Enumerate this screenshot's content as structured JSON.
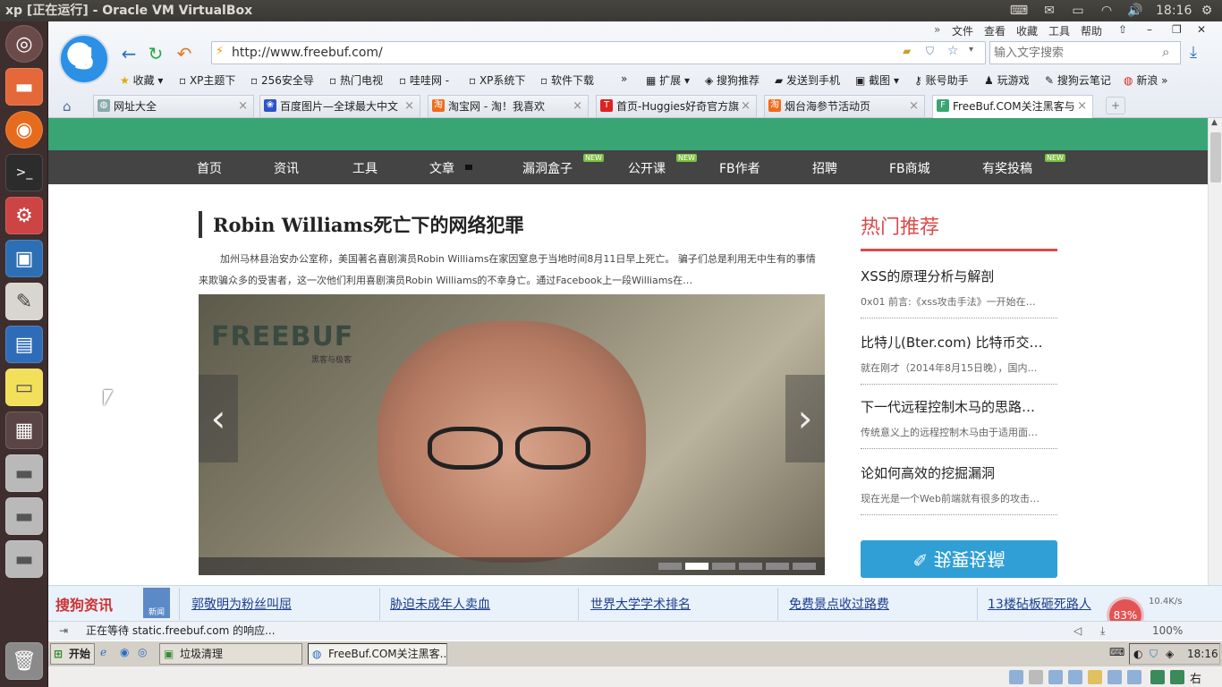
{
  "top_panel": {
    "title": "xp [正在运行] - Oracle VM VirtualBox",
    "clock": "18:16"
  },
  "launcher": {
    "items": [
      "ubuntu-dash",
      "files",
      "firefox",
      "terminal",
      "settings",
      "virtualbox",
      "text-editor",
      "libreoffice-writer",
      "sticky-notes",
      "workspace-switcher",
      "drive-1",
      "drive-2",
      "drive-3",
      "trash"
    ]
  },
  "browser": {
    "menu": [
      "文件",
      "查看",
      "收藏",
      "工具",
      "帮助"
    ],
    "url": "http://www.freebuf.com/",
    "search_placeholder": "输入文字搜索",
    "bookmarks": [
      "收藏",
      "XP主题下",
      "256安全导",
      "热门电视",
      "哇哇网 -",
      "XP系统下",
      "软件下载",
      "扩展",
      "搜狗推荐",
      "发送到手机",
      "截图",
      "账号助手",
      "玩游戏",
      "搜狗云笔记",
      "新浪"
    ],
    "tabs": [
      {
        "label": "网址大全",
        "active": false
      },
      {
        "label": "百度图片—全球最大中文",
        "active": false
      },
      {
        "label": "淘宝网 - 淘！我喜欢",
        "active": false
      },
      {
        "label": "首页-Huggies好奇官方旗",
        "active": false
      },
      {
        "label": "烟台海参节活动页",
        "active": false
      },
      {
        "label": "FreeBuf.COM关注黑客与",
        "active": true
      }
    ]
  },
  "site": {
    "nav": [
      {
        "label": "首页"
      },
      {
        "label": "资讯"
      },
      {
        "label": "工具"
      },
      {
        "label": "文章"
      },
      {
        "label": "漏洞盒子",
        "badge": "NEW"
      },
      {
        "label": "公开课",
        "badge": "NEW"
      },
      {
        "label": "FB作者"
      },
      {
        "label": "招聘"
      },
      {
        "label": "FB商城"
      },
      {
        "label": "有奖投稿",
        "badge": "NEW"
      }
    ],
    "article": {
      "title": "Robin Williams死亡下的网络犯罪",
      "summary": "加州马林县治安办公室称，美国著名喜剧演员Robin Williams在家因窒息于当地时间8月11日早上死亡。 骗子们总是利用无中生有的事情来欺骗众多的受害者，这一次他们利用喜剧演员Robin Williams的不幸身亡。通过Facebook上一段Williams在…",
      "slider_logo": "FREEBUF",
      "slider_logo_sub": "黑客与极客",
      "slider_prev": "‹",
      "slider_next": "›",
      "slide_count": 6,
      "active_slide": 2
    },
    "hot": {
      "title": "热门推荐",
      "items": [
        {
          "title": "XSS的原理分析与解剖",
          "desc": "0x01 前言:《xss攻击手法》一开始在…"
        },
        {
          "title": "比特儿(Bter.com) 比特币交…",
          "desc": "就在刚才（2014年8月15日晚），国内…"
        },
        {
          "title": "下一代远程控制木马的思路…",
          "desc": "传统意义上的远程控制木马由于适用面…"
        },
        {
          "title": "论如何高效的挖掘漏洞",
          "desc": "现在光是一个Web前端就有很多的攻击…"
        }
      ],
      "submit_label": "我要投稿"
    }
  },
  "news_bar": {
    "brand": "搜狗资讯",
    "badge": "新闻",
    "links": [
      "郭敬明为粉丝叫屈",
      "胁迫未成年人卖血",
      "世界大学学术排名",
      "免费景点收过路费",
      "13楼砧板砸死路人"
    ],
    "speed_percent": "83%",
    "speed_rate": "10.4K/s",
    "zoom": "100%"
  },
  "status": {
    "text": "正在等待 static.freebuf.com 的响应..."
  },
  "taskbar": {
    "start": "开始",
    "tasks": [
      {
        "label": "垃圾清理",
        "active": false
      },
      {
        "label": "FreeBuf.COM关注黑客...",
        "active": true
      }
    ],
    "clock": "18:16"
  },
  "vbox_strip": {
    "host_key": "右 Ctrl"
  }
}
